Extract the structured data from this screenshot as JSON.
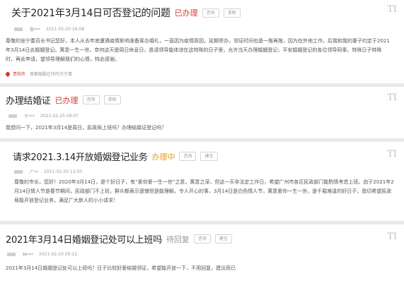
{
  "posts": [
    {
      "title": "关于2021年3月14日可否登记的问题",
      "status": "已办理",
      "tags": [
        "咨询",
        "求助"
      ],
      "type_icon": "TI",
      "author": "黎***",
      "date": "2021-02-20 16:08",
      "body": "尊敬的张宁委员长书记您好，本人从去年底遭遇疫情影响准备筹办婚礼，一直因为疫情原因，延期举办，领证时间也是一拖再拖，因为在外地工作，后我和我的妻子约定于2021年3月14日去婚姻登记。寓意一生一世，奈何这天是周日休息日，恳请领导能体谅在这特殊的日子里，允许当天办理婚姻登记，平安婚姻登记的各位领导同事，特殊日子特殊时，再此申请，望领导理解我们的心情，特此感谢。",
      "loc_label": "贵阳市",
      "loc_text": "首都婚姻在所所示于惠"
    },
    {
      "title": "办理结婚证",
      "status": "已办理",
      "tags": [
        "咨询",
        "求助"
      ],
      "type_icon": "TI",
      "author": "于***",
      "date": "2021-02-25 09:07",
      "body": "我想问一下，2021年3月14是周日，民政局上班吗？办理结婚证登记吗？"
    },
    {
      "title": "请求2021.3.14开放婚姻登记业务",
      "status": "办理中",
      "tags": [
        "咨询",
        "建言"
      ],
      "type_icon": "TI",
      "author": "广**",
      "date": "2021-02-20 13:50",
      "body": "尊敬的市长，您好！2020年3月14日，是个好日子，有“爱你爱一生一世”之意，寓意之深，但这一天非法定工作日，希望广州市各区民政部门能酌情考虑上班。由于2021年2月14日情人节是春节期间，民政部门不上班，群众都表示遗憾但是能理解，令人开心的事，3月14日是白色情人节，寓意爱你一生一世，是千载难逢的好日子，恳切希望民政局能开放登记业务，满足广大新人的小小请求！"
    },
    {
      "title": "2021年3月14日婚姻登记处可以上班吗",
      "status": "待回复",
      "tags": [
        "咨询",
        "建言"
      ],
      "type_icon": "TI",
      "author": "林***",
      "date": "2021-02-20 09:12",
      "body": "2021年3月14日婚姻登记处可以上班吗？日子比较好爱结婚领证，希望能开放一下，不用回复，建议而已"
    }
  ]
}
